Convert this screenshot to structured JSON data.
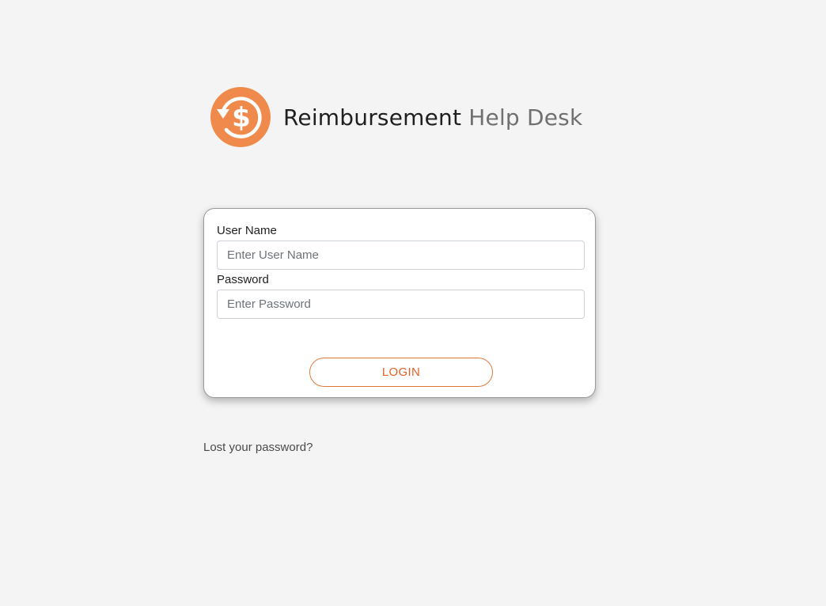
{
  "brand": {
    "name_strong": "Reimbursement",
    "name_light": "Help Desk",
    "logo_icon": "refund-dollar-icon",
    "accent_color": "#ef8a4c"
  },
  "login_form": {
    "username_label": "User Name",
    "username_placeholder": "Enter User Name",
    "username_value": "",
    "password_label": "Password",
    "password_placeholder": "Enter Password",
    "password_value": "",
    "login_button_label": "LOGIN",
    "button_color": "#e0602a"
  },
  "lost_password_link": "Lost your password?"
}
